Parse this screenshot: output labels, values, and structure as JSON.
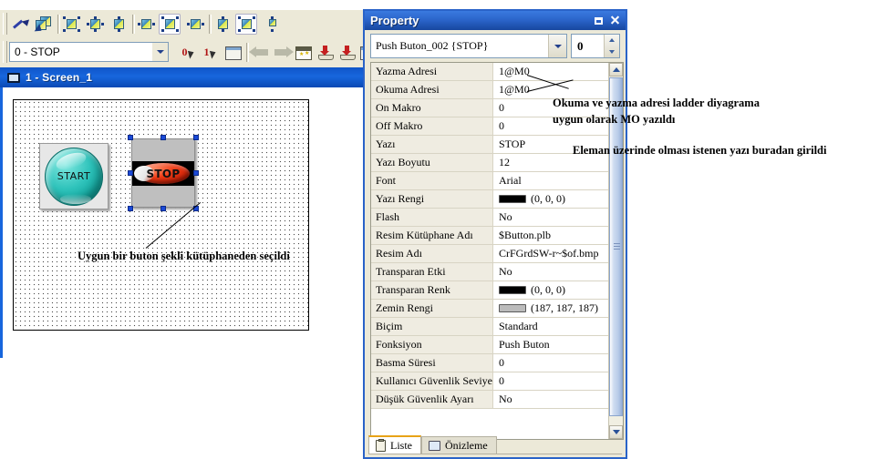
{
  "editor": {
    "toolbar": {
      "buttons": [
        {
          "name": "picker-tool",
          "icon": "eyedropper-icon"
        },
        {
          "name": "copy-properties-tool",
          "icon": "copy-properties-icon"
        },
        {
          "name": "align-selection-tool",
          "icon": "align-selection-icon"
        },
        {
          "name": "align-horizontal-spacing-tool",
          "icon": "align-horizontal-spacing-icon"
        },
        {
          "name": "align-center-tool",
          "icon": "align-center-icon"
        },
        {
          "name": "align-left-tool",
          "icon": "align-left-icon"
        },
        {
          "name": "align-middle-tool",
          "icon": "align-middle-icon"
        },
        {
          "name": "align-right-tool",
          "icon": "align-right-icon"
        },
        {
          "name": "align-top-tool",
          "icon": "align-top-icon"
        },
        {
          "name": "align-vertical-center-tool",
          "icon": "align-vertical-center-icon"
        },
        {
          "name": "align-bottom-tool",
          "icon": "align-bottom-icon"
        }
      ]
    },
    "state_combo": {
      "value": "0 - STOP"
    },
    "toolbar2": {
      "buttons": [
        {
          "name": "state-0-button",
          "label": "0"
        },
        {
          "name": "state-1-button",
          "label": "1"
        },
        {
          "name": "screen-properties-button",
          "icon": "window-properties-icon"
        },
        {
          "name": "previous-button",
          "icon": "arrow-left-icon"
        },
        {
          "name": "next-button",
          "icon": "arrow-right-icon"
        },
        {
          "name": "compile-button",
          "icon": "calendar-star-icon"
        },
        {
          "name": "download-button",
          "icon": "download-icon"
        },
        {
          "name": "upload-button",
          "icon": "upload-icon"
        },
        {
          "name": "transfer-button",
          "icon": "transfer-icon"
        }
      ]
    },
    "screen_title": "1 - Screen_1",
    "elements": {
      "start_button_caption": "START",
      "stop_button_caption": "STOP"
    },
    "annotation": "Uygun bir buton şekli kütüphaneden seçildi"
  },
  "annotations": {
    "address_note_line1": "Okuma ve yazma adresi ladder diyagrama",
    "address_note_line2": "uygun olarak MO yazıldı",
    "text_note": "Eleman üzerinde olması istenen yazı buradan girildi"
  },
  "property_window": {
    "title": "Property",
    "titlebar_buttons": [
      {
        "name": "restore-button",
        "icon": "restore-icon"
      },
      {
        "name": "close-button",
        "icon": "close-icon"
      }
    ],
    "element_combo": {
      "value": "Push Buton_002 {STOP}"
    },
    "state_spinner": {
      "value": "0"
    },
    "rows": [
      {
        "name": "Yazma Adresi",
        "value": "1@M0"
      },
      {
        "name": "Okuma Adresi",
        "value": "1@M0"
      },
      {
        "name": "On Makro",
        "value": "0"
      },
      {
        "name": "Off Makro",
        "value": "0"
      },
      {
        "name": "Yazı",
        "value": "STOP"
      },
      {
        "name": "Yazı Boyutu",
        "value": "12"
      },
      {
        "name": "Font",
        "value": "Arial"
      },
      {
        "name": "Yazı Rengi",
        "value": "(0, 0, 0)",
        "swatch": "#000000"
      },
      {
        "name": "Flash",
        "value": "No"
      },
      {
        "name": "Resim Kütüphane Adı",
        "value": "$Button.plb"
      },
      {
        "name": "Resim Adı",
        "value": "CrFGrdSW-r~$of.bmp"
      },
      {
        "name": "Transparan Etki",
        "value": "No"
      },
      {
        "name": "Transparan Renk",
        "value": "(0, 0, 0)",
        "swatch": "#000000"
      },
      {
        "name": "Zemin Rengi",
        "value": "(187, 187, 187)",
        "swatch": "#bbbbbb"
      },
      {
        "name": "Biçim",
        "value": "Standard"
      },
      {
        "name": "Fonksiyon",
        "value": "Push Buton"
      },
      {
        "name": "Basma Süresi",
        "value": "0"
      },
      {
        "name": "Kullanıcı Güvenlik Seviyes",
        "value": "0"
      },
      {
        "name": "Düşük Güvenlik Ayarı",
        "value": "No"
      }
    ],
    "tabs": [
      {
        "label": "Liste",
        "icon": "clipboard-icon",
        "active": true
      },
      {
        "label": "Önizleme",
        "icon": "monitor-icon",
        "active": false
      }
    ]
  },
  "colors": {
    "titlebar_blue": "#2a63c8",
    "screen_titlebar_blue": "#1766dd",
    "window_face": "#ece9d8",
    "property_name_bg": "#efece1"
  }
}
